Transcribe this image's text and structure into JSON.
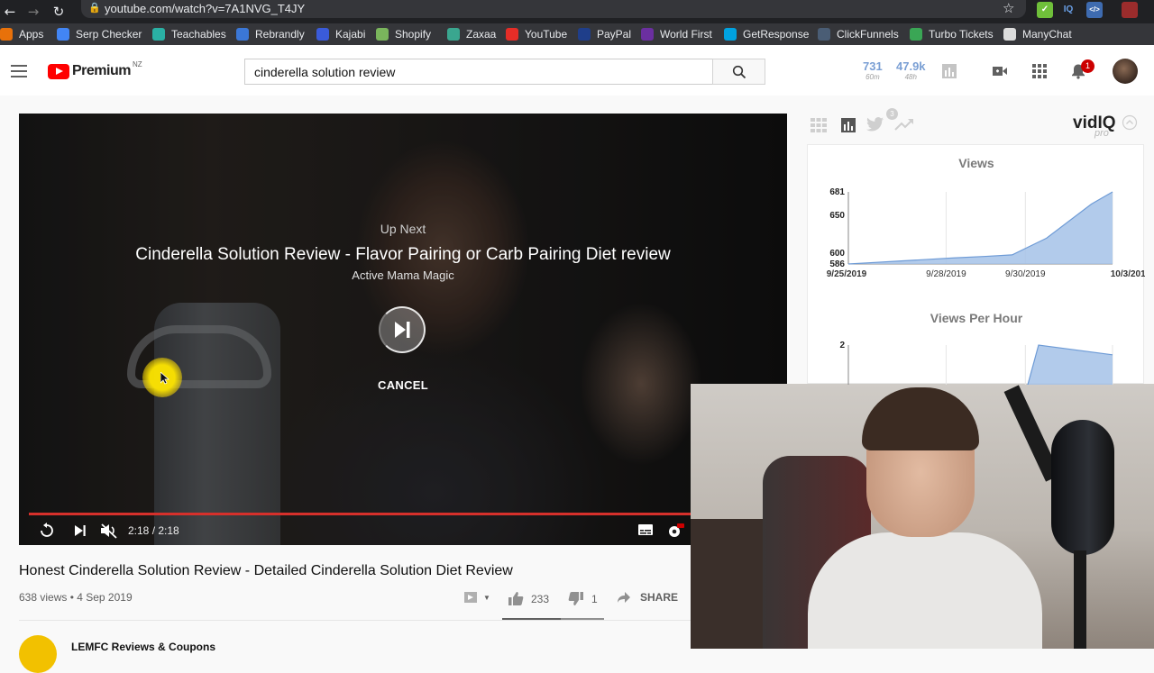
{
  "browser": {
    "url": "youtube.com/watch?v=7A1NVG_T4JY",
    "extensions": [
      {
        "name": "check-extension",
        "label": "",
        "color": "#6fbf3a"
      },
      {
        "name": "vidiq-extension",
        "label": "IQ",
        "color": "#2b6cb0"
      },
      {
        "name": "code-extension",
        "label": "</>",
        "color": "#3e6bb0"
      },
      {
        "name": "profile-extension",
        "label": "",
        "color": "#9b2c2c"
      }
    ]
  },
  "bookmarks": [
    {
      "label": "Apps",
      "icon": "apps-grid-icon",
      "color": "#e8710a"
    },
    {
      "label": "Serp Checker",
      "icon": "plus-icon",
      "color": "#4285f4"
    },
    {
      "label": "Teachables",
      "icon": "teachable-icon",
      "color": "#2ab0a4"
    },
    {
      "label": "Rebrandly",
      "icon": "rebrandly-icon",
      "color": "#3b77d6"
    },
    {
      "label": "Kajabi",
      "icon": "kajabi-icon",
      "color": "#3a5bd9"
    },
    {
      "label": "Shopify",
      "icon": "shopify-icon",
      "color": "#7ab55c"
    },
    {
      "label": "Zaxaa",
      "icon": "zaxaa-icon",
      "color": "#3aa68f"
    },
    {
      "label": "YouTube",
      "icon": "youtube-icon",
      "color": "#e52d27"
    },
    {
      "label": "PayPal",
      "icon": "paypal-icon",
      "color": "#1f3e8a"
    },
    {
      "label": "World First",
      "icon": "worldfirst-icon",
      "color": "#6b2fa0"
    },
    {
      "label": "GetResponse",
      "icon": "mail-icon",
      "color": "#00a2e0"
    },
    {
      "label": "ClickFunnels",
      "icon": "clickfunnels-icon",
      "color": "#4a5d75"
    },
    {
      "label": "Turbo Tickets",
      "icon": "ticket-icon",
      "color": "#3aa655"
    },
    {
      "label": "ManyChat",
      "icon": "manychat-icon",
      "color": "#dcdcdc"
    }
  ],
  "header": {
    "logo_text": "Premium",
    "region": "NZ",
    "search_value": "cinderella solution review",
    "search_placeholder": "Search",
    "stats": [
      {
        "value": "731",
        "label": "60m"
      },
      {
        "value": "47.9k",
        "label": "48h"
      }
    ],
    "notification_count": "1"
  },
  "player": {
    "up_next_label": "Up Next",
    "up_next_title": "Cinderella Solution Review - Flavor Pairing or Carb Pairing Diet review",
    "up_next_channel": "Active Mama Magic",
    "cancel_label": "CANCEL",
    "time": "2:18 / 2:18",
    "progress_fraction": 1.0
  },
  "video": {
    "title": "Honest Cinderella Solution Review - Detailed Cinderella Solution Diet Review",
    "meta": "638 views • 4 Sep 2019",
    "likes": "233",
    "dislikes": "1",
    "share_label": "SHARE",
    "like_ratio": 0.996
  },
  "channel": {
    "name": "LEMFC Reviews & Coupons"
  },
  "vidiq": {
    "logo": "vidIQ",
    "tier": "pro",
    "twitter_badge": "3",
    "accent_color": "#a4c2e8",
    "line_color": "#6e9bd6"
  },
  "chart_data": [
    {
      "type": "area",
      "title": "Views",
      "x": [
        "9/25/2019",
        "9/26/2019",
        "9/27/2019",
        "9/28/2019",
        "9/29/2019",
        "9/30/2019",
        "10/1/2019",
        "10/2/2019",
        "10/2/2019 12:00",
        "10/3/2019"
      ],
      "y": [
        586,
        588,
        590,
        592,
        594,
        596,
        598,
        620,
        665,
        681
      ],
      "x_tick_labels": [
        "9/25/2019",
        "9/28/2019",
        "9/30/2019",
        "10/3/2019"
      ],
      "y_tick_labels": [
        "681",
        "650",
        "600",
        "586"
      ],
      "ylim": [
        586,
        681
      ],
      "grid": true
    },
    {
      "type": "area",
      "title": "Views Per Hour",
      "y_tick_labels": [
        "2"
      ],
      "x": [
        "9/25/2019",
        "9/26/2019",
        "9/27/2019",
        "9/28/2019",
        "9/29/2019",
        "9/30/2019",
        "10/1/2019",
        "10/2/2019",
        "10/3/2019"
      ],
      "y": [
        0,
        0,
        0,
        0,
        0,
        0,
        1.2,
        2,
        1.8
      ],
      "ylim": [
        0,
        2
      ],
      "grid": true
    }
  ]
}
